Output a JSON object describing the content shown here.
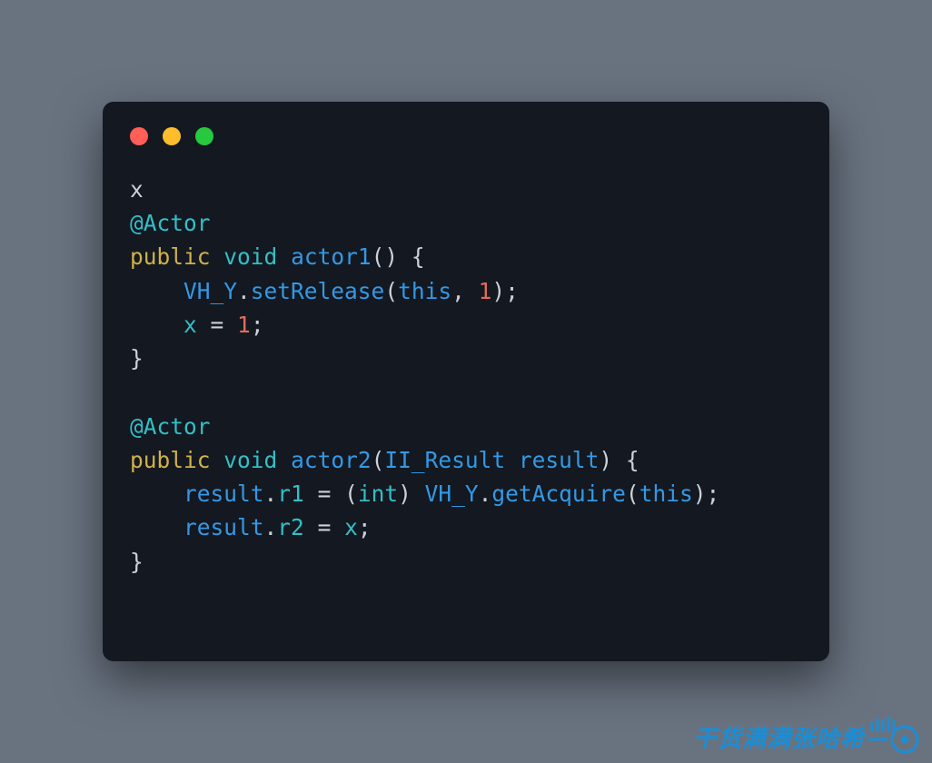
{
  "window": {
    "traffic_lights": {
      "red": "#ff5f56",
      "yellow": "#ffbd2e",
      "green": "#27c93f"
    }
  },
  "code": {
    "line1": {
      "x": "x"
    },
    "line2": {
      "annot": "@Actor"
    },
    "line3": {
      "kw": "public",
      "type": "void",
      "fn": "actor1",
      "parens": "()",
      "brace": " {"
    },
    "line4": {
      "indent": "    ",
      "obj": "VH_Y",
      "dot": ".",
      "m": "setRelease",
      "open": "(",
      "this": "this",
      "comma": ", ",
      "num": "1",
      "close": ");"
    },
    "line5": {
      "indent": "    ",
      "var": "x",
      "eq": " = ",
      "num": "1",
      "semi": ";"
    },
    "line6": {
      "brace": "}"
    },
    "blank": "",
    "line8": {
      "annot": "@Actor"
    },
    "line9": {
      "kw": "public",
      "type": "void",
      "fn": "actor2",
      "open": "(",
      "ptype": "II_Result",
      "pname": " result",
      "close": ")",
      "brace": " {"
    },
    "line10": {
      "indent": "    ",
      "obj": "result",
      "dot1": ".",
      "field": "r1",
      "eq": " = ",
      "castO": "(",
      "cast": "int",
      "castC": ") ",
      "obj2": "VH_Y",
      "dot2": ".",
      "m": "getAcquire",
      "open": "(",
      "this": "this",
      "close": ");"
    },
    "line11": {
      "indent": "    ",
      "obj": "result",
      "dot": ".",
      "field": "r2",
      "eq": " = ",
      "var": "x",
      "semi": ";"
    },
    "line12": {
      "brace": "}"
    }
  },
  "watermark": {
    "text": "干货满满张哈希"
  }
}
